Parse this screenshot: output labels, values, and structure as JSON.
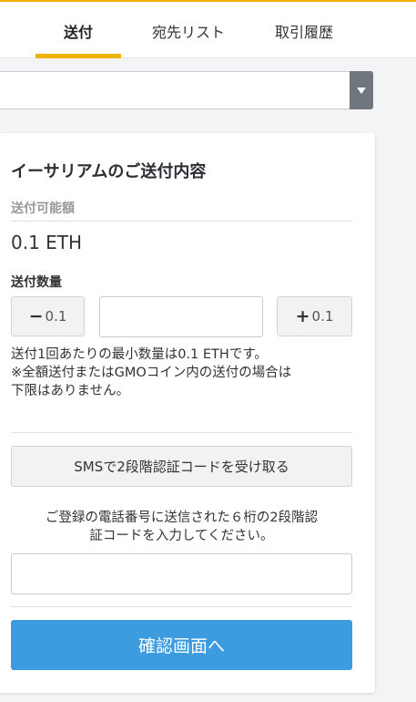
{
  "tabs": {
    "items": [
      {
        "label": "送付",
        "active": true
      },
      {
        "label": "宛先リスト",
        "active": false
      },
      {
        "label": "取引履歴",
        "active": false
      }
    ]
  },
  "select": {
    "value": "",
    "arrow_icon": "triangle-down-icon"
  },
  "card": {
    "title": "イーサリアムのご送付内容",
    "available_label": "送付可能額",
    "available_value": "0.1 ETH",
    "quantity_label": "送付数量",
    "minus_button": {
      "sign": "−",
      "value": "0.1"
    },
    "plus_button": {
      "sign": "+",
      "value": "0.1"
    },
    "quantity_input": {
      "value": "",
      "placeholder": ""
    },
    "min_note": "送付1回あたりの最小数量は0.1 ETHです。\n※全額送付またはGMOコイン内の送付の場合は\n下限はありません。",
    "sms_button_label": "SMSで2段階認証コードを受け取る",
    "sms_note_line1": "ご登録の電話番号に送信された６桁の2段階認",
    "sms_note_line2": "証コードを入力してください。",
    "code_input": {
      "value": "",
      "placeholder": ""
    },
    "confirm_button_label": "確認画面へ"
  },
  "colors": {
    "accent": "#f0b400",
    "primary_button": "#3d9be0",
    "select_arrow_bg": "#6f767e"
  }
}
